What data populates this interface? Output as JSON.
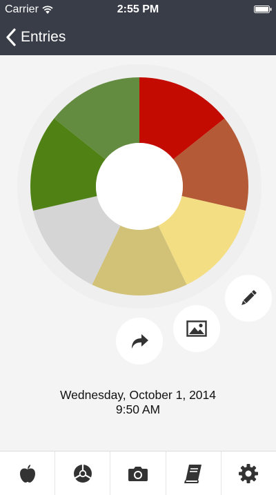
{
  "status_bar": {
    "carrier": "Carrier",
    "time": "2:55 PM"
  },
  "nav": {
    "back_label": "Entries"
  },
  "mood_wheel": {
    "segments": [
      {
        "name": "red",
        "color": "#c40b02"
      },
      {
        "name": "rust",
        "color": "#b55a37"
      },
      {
        "name": "yellow",
        "color": "#f3de84"
      },
      {
        "name": "khaki",
        "color": "#d1c278"
      },
      {
        "name": "gray",
        "color": "#d5d5d5"
      },
      {
        "name": "green",
        "color": "#4f8114"
      },
      {
        "name": "olive-green",
        "color": "#648c40"
      }
    ],
    "center_color": "#ffffff",
    "ring_color": "#efefef"
  },
  "actions": {
    "edit_icon": "pencil-icon",
    "photo_icon": "image-icon",
    "share_icon": "share-arrow-icon"
  },
  "entry": {
    "date": "Wednesday, October 1, 2014",
    "time": "9:50 AM"
  },
  "tabbar": {
    "tabs": [
      {
        "icon": "apple-icon"
      },
      {
        "icon": "aperture-icon"
      },
      {
        "icon": "camera-icon"
      },
      {
        "icon": "book-icon"
      },
      {
        "icon": "gear-icon"
      }
    ]
  },
  "colors": {
    "header_bg": "#393d48",
    "page_bg": "#f4f4f4",
    "icon_dark": "#333333"
  }
}
